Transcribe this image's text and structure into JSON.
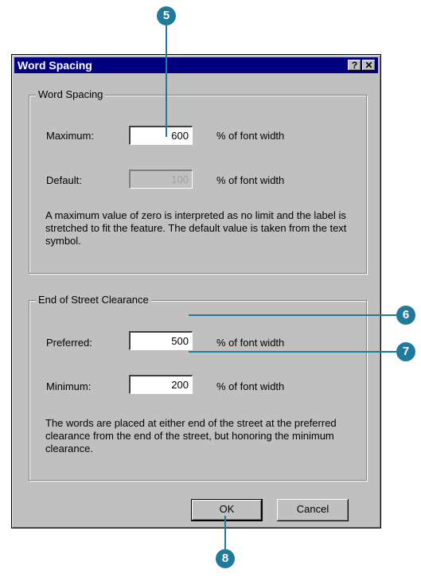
{
  "dialog": {
    "title": "Word Spacing",
    "help_glyph": "?",
    "close_glyph": "✕"
  },
  "word_spacing": {
    "legend": "Word Spacing",
    "maximum_label": "Maximum:",
    "maximum_value": "600",
    "maximum_unit": "% of font width",
    "default_label": "Default:",
    "default_value": "100",
    "default_unit": "% of font width",
    "description": "A maximum value of zero is interpreted as no limit and the label is stretched to fit the feature. The default value is taken from the text symbol."
  },
  "clearance": {
    "legend": "End of Street Clearance",
    "preferred_label": "Preferred:",
    "preferred_value": "500",
    "preferred_unit": "% of font width",
    "minimum_label": "Minimum:",
    "minimum_value": "200",
    "minimum_unit": "% of font width",
    "description": "The words are placed at either end of the street at the preferred clearance from the end of the street, but honoring the minimum clearance."
  },
  "buttons": {
    "ok": "OK",
    "cancel": "Cancel"
  },
  "callouts": {
    "c5": "5",
    "c6": "6",
    "c7": "7",
    "c8": "8"
  },
  "colors": {
    "callout": "#1f7a9c",
    "titlebar": "#000080"
  }
}
